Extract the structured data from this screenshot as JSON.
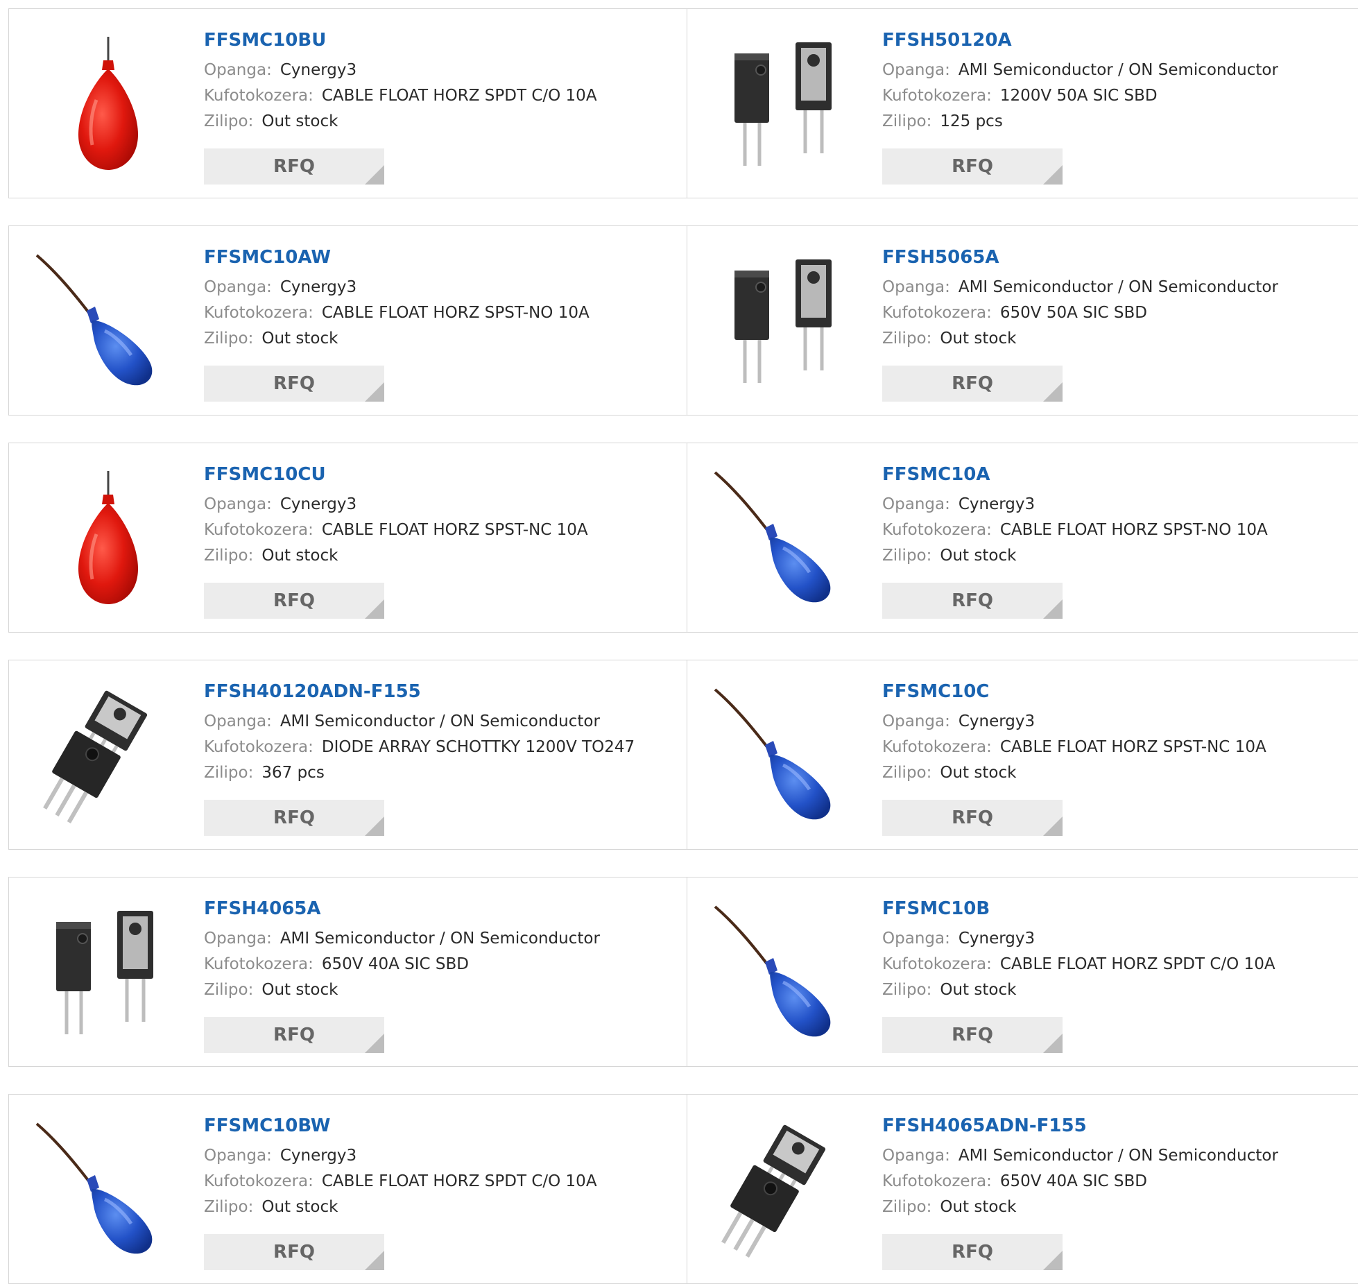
{
  "labels": {
    "manufacturer": "Opanga:",
    "description": "Kufotokozera:",
    "stock": "Zilipo:",
    "rfq": "RFQ"
  },
  "products": [
    {
      "part": "FFSMC10BU",
      "manufacturer": "Cynergy3",
      "description": "CABLE FLOAT HORZ SPDT C/O 10A",
      "stock": "Out stock",
      "image": "red-float-switch"
    },
    {
      "part": "FFSH50120A",
      "manufacturer": "AMI Semiconductor / ON Semiconductor",
      "description": "1200V 50A SIC SBD",
      "stock": "125 pcs",
      "image": "to247-2-lead-diode"
    },
    {
      "part": "FFSMC10AW",
      "manufacturer": "Cynergy3",
      "description": "CABLE FLOAT HORZ SPST-NO 10A",
      "stock": "Out stock",
      "image": "blue-float-switch"
    },
    {
      "part": "FFSH5065A",
      "manufacturer": "AMI Semiconductor / ON Semiconductor",
      "description": "650V 50A SIC SBD",
      "stock": "Out stock",
      "image": "to247-2-lead-diode"
    },
    {
      "part": "FFSMC10CU",
      "manufacturer": "Cynergy3",
      "description": "CABLE FLOAT HORZ SPST-NC 10A",
      "stock": "Out stock",
      "image": "red-float-switch"
    },
    {
      "part": "FFSMC10A",
      "manufacturer": "Cynergy3",
      "description": "CABLE FLOAT HORZ SPST-NO 10A",
      "stock": "Out stock",
      "image": "blue-float-switch"
    },
    {
      "part": "FFSH40120ADN-F155",
      "manufacturer": "AMI Semiconductor / ON Semiconductor",
      "description": "DIODE ARRAY SCHOTTKY 1200V TO247",
      "stock": "367 pcs",
      "image": "to247-3-lead-package"
    },
    {
      "part": "FFSMC10C",
      "manufacturer": "Cynergy3",
      "description": "CABLE FLOAT HORZ SPST-NC 10A",
      "stock": "Out stock",
      "image": "blue-float-switch"
    },
    {
      "part": "FFSH4065A",
      "manufacturer": "AMI Semiconductor / ON Semiconductor",
      "description": "650V 40A SIC SBD",
      "stock": "Out stock",
      "image": "to247-2-lead-diode"
    },
    {
      "part": "FFSMC10B",
      "manufacturer": "Cynergy3",
      "description": "CABLE FLOAT HORZ SPDT C/O 10A",
      "stock": "Out stock",
      "image": "blue-float-switch"
    },
    {
      "part": "FFSMC10BW",
      "manufacturer": "Cynergy3",
      "description": "CABLE FLOAT HORZ SPDT C/O 10A",
      "stock": "Out stock",
      "image": "blue-float-switch"
    },
    {
      "part": "FFSH4065ADN-F155",
      "manufacturer": "AMI Semiconductor / ON Semiconductor",
      "description": "650V 40A SIC SBD",
      "stock": "Out stock",
      "image": "to247-3-lead-package"
    }
  ]
}
